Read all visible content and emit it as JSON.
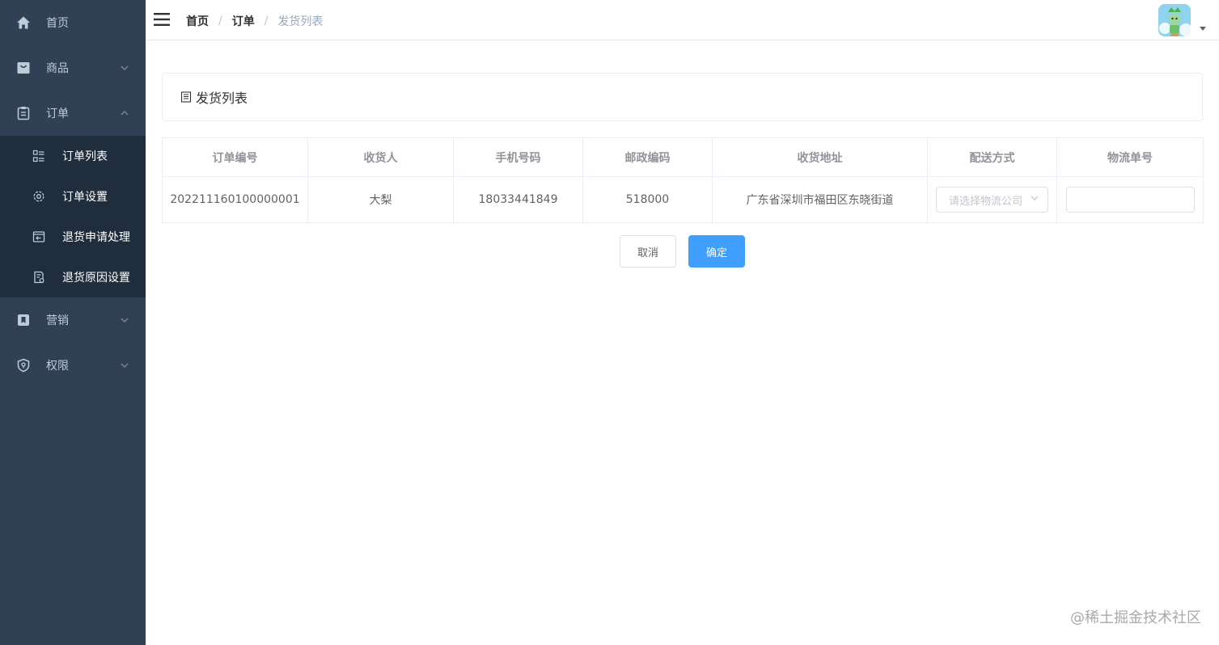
{
  "sidebar": {
    "items": [
      {
        "label": "首页",
        "icon": "home-icon"
      },
      {
        "label": "商品",
        "icon": "shopping-bag-icon"
      },
      {
        "label": "订单",
        "icon": "clipboard-icon"
      },
      {
        "label": "营销",
        "icon": "bookmark-icon"
      },
      {
        "label": "权限",
        "icon": "shield-icon"
      }
    ],
    "order_submenu": [
      {
        "label": "订单列表",
        "icon": "list-icon"
      },
      {
        "label": "订单设置",
        "icon": "gear-icon"
      },
      {
        "label": "退货申请处理",
        "icon": "return-box-icon"
      },
      {
        "label": "退货原因设置",
        "icon": "document-settings-icon"
      }
    ]
  },
  "header": {
    "breadcrumb": [
      "首页",
      "订单",
      "发货列表"
    ],
    "separator": "/"
  },
  "card": {
    "title": "发货列表"
  },
  "table": {
    "columns": [
      "订单编号",
      "收货人",
      "手机号码",
      "邮政编码",
      "收货地址",
      "配送方式",
      "物流单号"
    ],
    "rows": [
      {
        "order_no": "202211160100000001",
        "receiver": "大梨",
        "phone": "18033441849",
        "postcode": "518000",
        "address": "广东省深圳市福田区东晓街道",
        "delivery_placeholder": "请选择物流公司",
        "tracking_no": ""
      }
    ]
  },
  "actions": {
    "cancel_label": "取消",
    "confirm_label": "确定"
  },
  "watermark": "@稀土掘金技术社区",
  "colors": {
    "sidebar_bg": "#304156",
    "submenu_bg": "#1f2d3d",
    "primary": "#409eff"
  }
}
